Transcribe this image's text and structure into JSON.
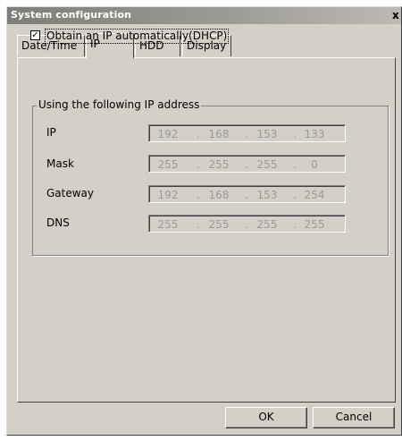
{
  "window": {
    "title": "System configuration",
    "close_glyph": "x"
  },
  "tabs": [
    {
      "label": "Date/Time",
      "active": false
    },
    {
      "label": "IP",
      "active": true
    },
    {
      "label": "HDD",
      "active": false
    },
    {
      "label": "Display",
      "active": false
    }
  ],
  "dhcp": {
    "label": "Obtain an IP automatically(DHCP)",
    "checked": true,
    "check_glyph": "✓"
  },
  "group": {
    "title": "Using the following IP address",
    "fields": [
      {
        "label": "IP",
        "octets": [
          "192",
          "168",
          "153",
          "133"
        ]
      },
      {
        "label": "Mask",
        "octets": [
          "255",
          "255",
          "255",
          "0"
        ]
      },
      {
        "label": "Gateway",
        "octets": [
          "192",
          "168",
          "153",
          "254"
        ]
      },
      {
        "label": "DNS",
        "octets": [
          "255",
          "255",
          "255",
          "255"
        ]
      }
    ]
  },
  "buttons": {
    "ok": "OK",
    "cancel": "Cancel"
  },
  "colors": {
    "dialog_bg": "#d4d0c8",
    "disabled_text": "#9a9a9a",
    "title_text": "#ffffff"
  }
}
